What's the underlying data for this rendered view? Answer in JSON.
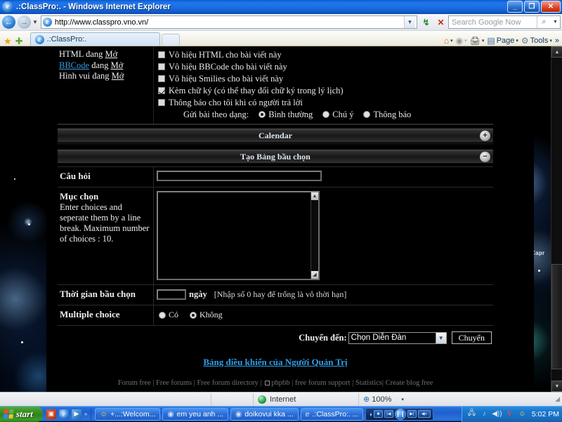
{
  "window": {
    "title": ".:ClassPro:. - Windows Internet Explorer",
    "minimize_label": "_",
    "maximize_label": "❐",
    "close_label": "✕"
  },
  "address_bar": {
    "url": "http://www.classpro.vno.vn/",
    "back_icon": "back-arrow-icon",
    "forward_icon": "forward-arrow-icon",
    "refresh_label": "↯",
    "stop_label": "✕",
    "search_placeholder": "Search Google Now",
    "search_icon": "magnifier-icon"
  },
  "tabs": {
    "favorites_icon": "star-icon",
    "add_favorites_icon": "add-star-icon",
    "items": [
      {
        "label": ".:ClassPro:."
      }
    ],
    "new_tab_label": ""
  },
  "command_bar": {
    "home_label": "",
    "feeds_label": "",
    "print_label": "",
    "page_label": "Page",
    "tools_label": "Tools",
    "overflow_label": "»"
  },
  "post_options": {
    "left_lines": [
      {
        "pre": "HTML đang ",
        "link": "",
        "mid": "",
        "underline": "Mở"
      },
      {
        "pre": "",
        "link": "BBCode",
        "mid": " đang ",
        "underline": "Mở"
      },
      {
        "pre": "Hình vui đang ",
        "link": "",
        "mid": "",
        "underline": "Mở"
      }
    ],
    "checkboxes": [
      {
        "label": "Vô hiệu HTML cho bài viết này",
        "checked": false
      },
      {
        "label": "Vô hiệu BBCode cho bài viết này",
        "checked": false
      },
      {
        "label": "Vô hiệu Smilies cho bài viết này",
        "checked": false
      },
      {
        "label": "Kèm chữ ký (có thể thay đổi chữ ký trong lý lịch)",
        "checked": true
      },
      {
        "label": "Thông báo cho tôi khi có người trả lời",
        "checked": false
      }
    ],
    "post_type_label": "Gửi bài theo dạng:",
    "post_types": [
      {
        "label": "Bình thường",
        "selected": true
      },
      {
        "label": "Chú ý",
        "selected": false
      },
      {
        "label": "Thông báo",
        "selected": false
      }
    ]
  },
  "panels": [
    {
      "title": "Calendar",
      "toggle": "+",
      "expanded": false
    },
    {
      "title": "Tạo Bảng bầu chọn",
      "toggle": "−",
      "expanded": true
    }
  ],
  "poll_form": {
    "question": {
      "label": "Câu hỏi",
      "value": "",
      "placeholder": ""
    },
    "choices": {
      "label": "Mục chọn",
      "help": "Enter choices and seperate them by a line break. Maximum number of choices : 10.",
      "value": ""
    },
    "duration": {
      "label": "Thời gian bầu chọn",
      "value": "",
      "unit": "ngày",
      "note": "[Nhập số 0 hay để trống là vô thời hạn]"
    },
    "multiple": {
      "label": "Multiple choice",
      "options": [
        {
          "label": "Có",
          "selected": false
        },
        {
          "label": "Không",
          "selected": true
        }
      ]
    }
  },
  "jumpbox": {
    "label": "Chuyển đến:",
    "selected": "Chọn Diễn Đàn",
    "button": "Chuyển"
  },
  "admin_link": "Bảng điều khiển của Người Quản Trị",
  "footer_links": [
    "Forum free",
    "Free forums",
    "Free forum directory",
    "phpbb",
    "free forum support",
    "Statistics",
    "Create blog free"
  ],
  "wallpaper": {
    "constellation_label": "Capr"
  },
  "status_bar": {
    "zone": "Internet",
    "zone_icon": "globe-icon",
    "zoom": "100%",
    "zoom_icon": "zoom-icon",
    "zoom_caret": "▾"
  },
  "taskbar": {
    "start_label": "start",
    "quick_launch": [
      {
        "name": "show-desktop-icon",
        "glyph": "▣"
      },
      {
        "name": "internet-explorer-icon",
        "glyph": "e"
      },
      {
        "name": "media-player-icon",
        "glyph": "▶"
      },
      {
        "name": "quick-launch-overflow",
        "glyph": "»"
      }
    ],
    "tasks": [
      {
        "label": "+...:Welcom...",
        "icon": "smiley-icon"
      },
      {
        "label": "em yeu anh ...",
        "icon": "browser-icon"
      },
      {
        "label": "doikovui kka ...",
        "icon": "browser-icon"
      },
      {
        "label": ".:ClassPro:. ...",
        "icon": "internet-explorer-icon"
      }
    ],
    "media_controls": {
      "stop": "■",
      "prev": "|◀",
      "play": "❙❙",
      "next": "▶|",
      "volume": "🔊"
    },
    "tray": [
      {
        "name": "network-icon",
        "glyph": "🖧"
      },
      {
        "name": "sound-icon",
        "glyph": "♪"
      },
      {
        "name": "volume-icon",
        "glyph": "🔊"
      },
      {
        "name": "vietkey-icon",
        "glyph": "V"
      },
      {
        "name": "yahoo-messenger-icon",
        "glyph": "☺"
      }
    ],
    "clock": "5:02 PM"
  }
}
